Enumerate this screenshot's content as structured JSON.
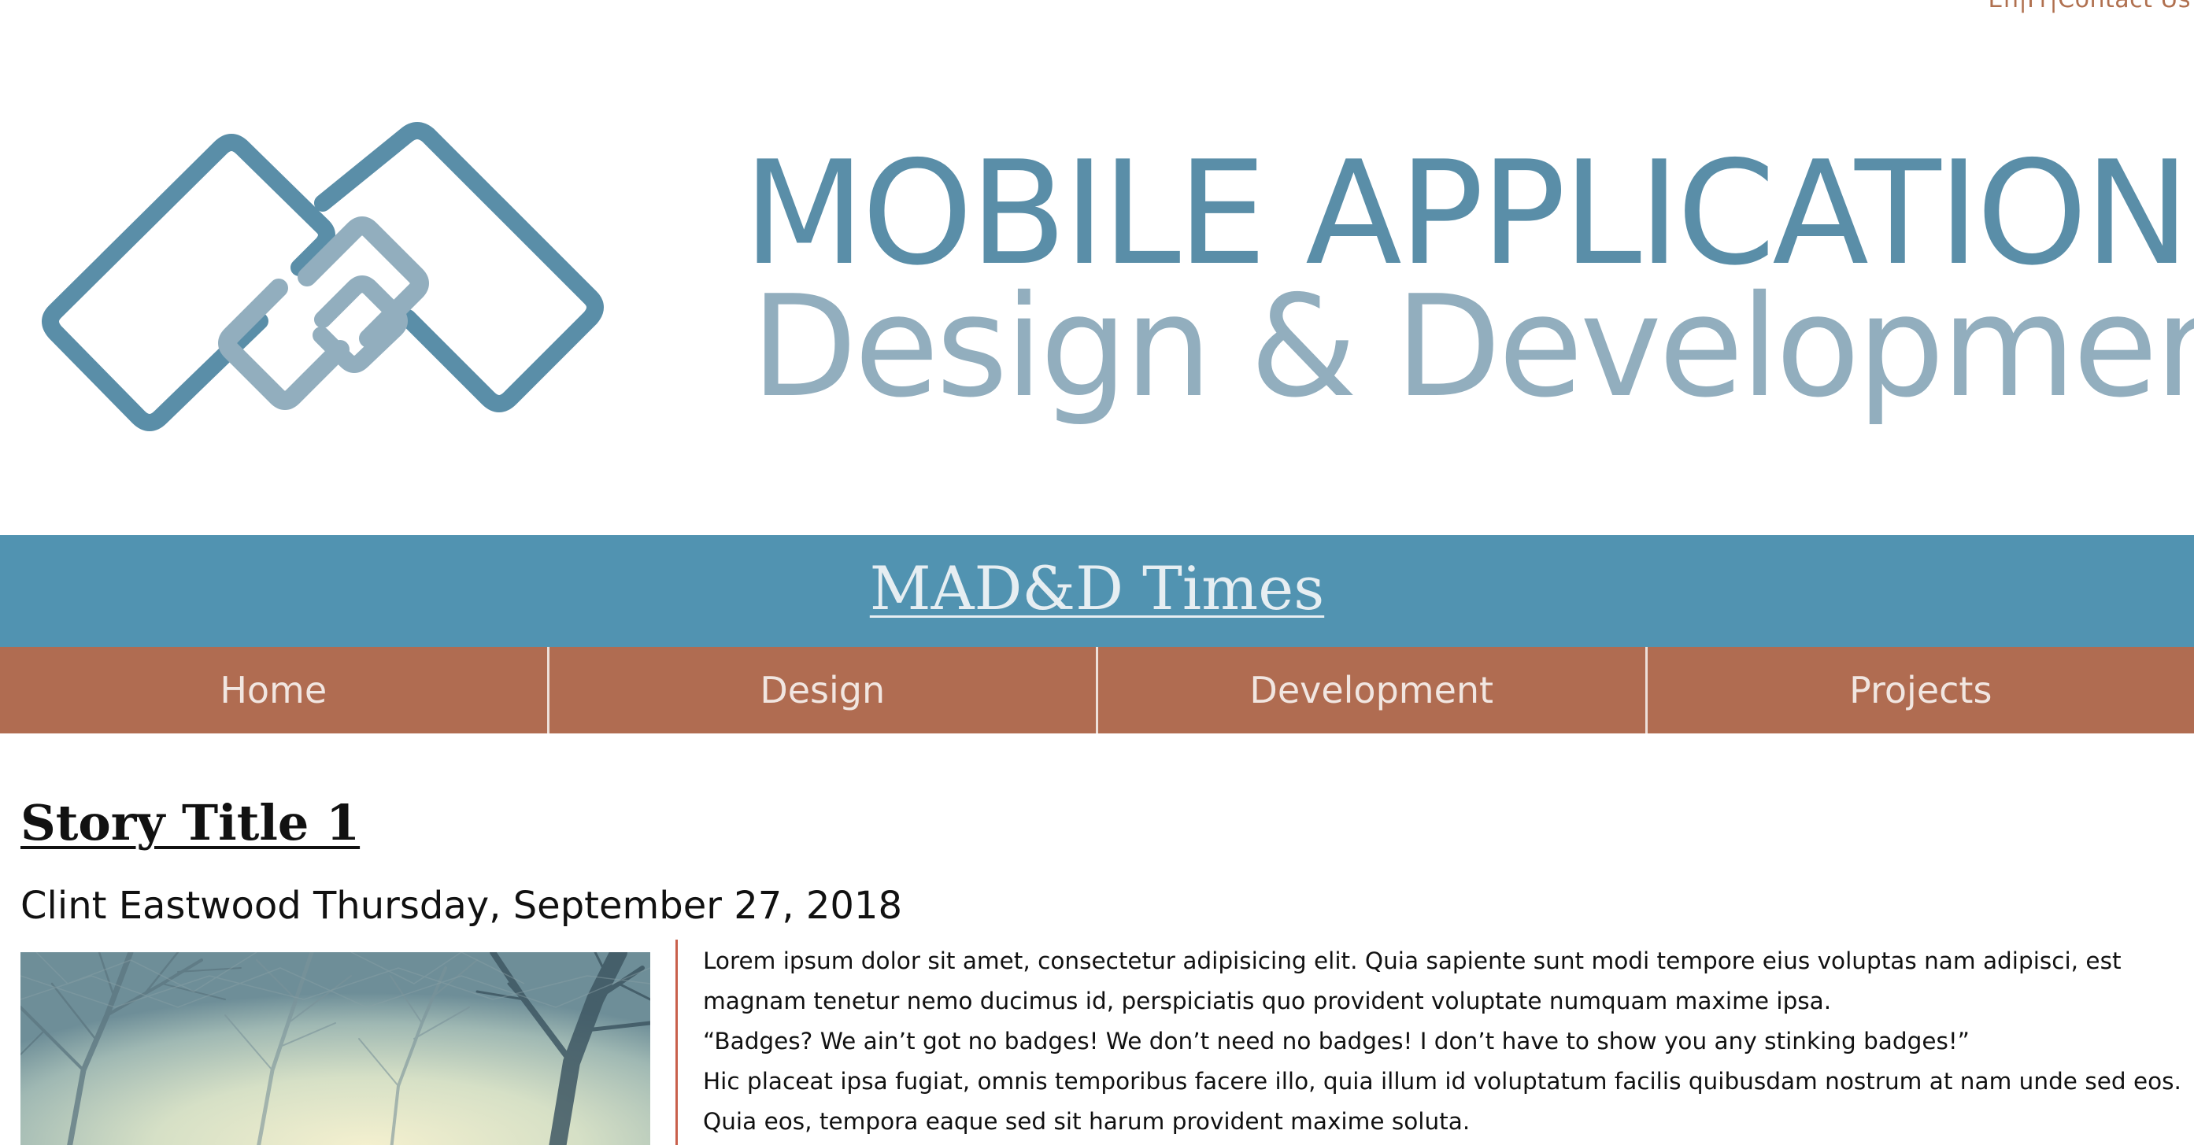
{
  "top_links": {
    "lang": "En",
    "separator": "|",
    "lang_alt": "Fr",
    "separator2": "|",
    "contact": "Contact Us"
  },
  "banner": {
    "logo_alt": "logo-mark",
    "line1": "MOBILE APPLICATION",
    "line2": "Design & Development"
  },
  "site_title": "MAD&D Times",
  "nav": {
    "items": [
      {
        "label": "Home"
      },
      {
        "label": "Design"
      },
      {
        "label": "Development"
      },
      {
        "label": "Projects"
      }
    ]
  },
  "story": {
    "title": "Story Title 1",
    "byline": "Clint Eastwood Thursday, September 27, 2018",
    "paragraphs": [
      "Lorem ipsum dolor sit amet, consectetur adipisicing elit. Quia sapiente sunt modi tempore eius voluptas nam adipisci, est magnam tenetur nemo ducimus id, perspiciatis quo provident voluptate numquam maxime ipsa.",
      "“Badges? We ain’t got no badges! We don’t need no badges! I don’t have to show you any stinking badges!”",
      "Hic placeat ipsa fugiat, omnis temporibus facere illo, quia illum id voluptatum facilis quibusdam nostrum at nam unde sed eos. Quia eos, tempora eaque sed sit harum provident maxime soluta."
    ]
  },
  "colors": {
    "title_bar": "#5193b1",
    "nav": "#b06c51",
    "logo_dark": "#5a8ea8",
    "logo_light": "#92aebe",
    "link": "#b0704f",
    "divider": "#c9604c"
  }
}
